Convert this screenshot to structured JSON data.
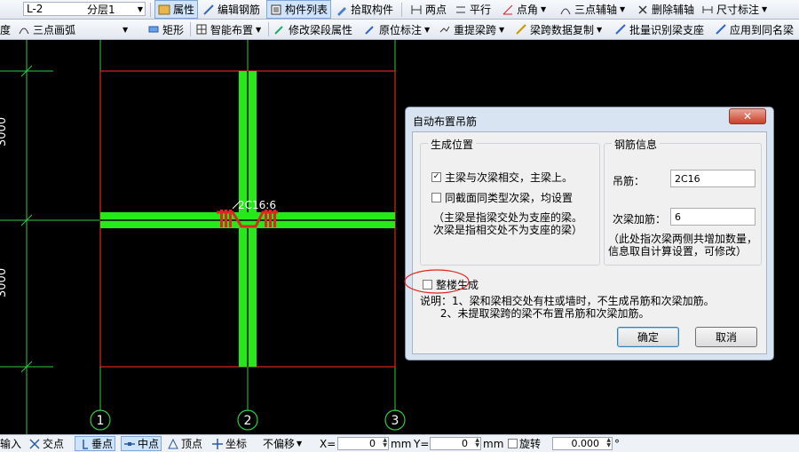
{
  "toolbar1": {
    "layer_combo": "L-2",
    "floor_combo": "分层1",
    "props": "属性",
    "edit_rebar": "编辑钢筋",
    "component_list": "构件列表",
    "pick_component": "拾取构件",
    "two_points": "两点",
    "parallel": "平行",
    "point_angle": "点角",
    "three_point_axis": "三点辅轴",
    "delete_axis": "删除辅轴",
    "dimension": "尺寸标注"
  },
  "toolbar2": {
    "degree": "度",
    "arc_combo": "三点画弧",
    "rect": "矩形",
    "smart_layout": "智能布置",
    "modify_beam_seg": "修改梁段属性",
    "origin_mark": "原位标注",
    "re_extract_span": "重提梁跨",
    "span_data_copy": "梁跨数据复制",
    "batch_identify": "批量识别梁支座",
    "apply_same_beam": "应用到同名梁"
  },
  "canvas": {
    "dim_top": "3000",
    "dim_bottom": "3000",
    "beam_label": "2C16:6",
    "axis_labels": [
      "1",
      "2",
      "3"
    ]
  },
  "dialog": {
    "title": "自动布置吊筋",
    "close": "✕",
    "gen_position_title": "生成位置",
    "opt_main_secondary": "主梁与次梁相交，主梁上。",
    "opt_main_secondary_checked": true,
    "opt_same_section": "同截面同类型次梁，均设置",
    "opt_same_section_checked": false,
    "position_note": "（主梁是指梁交处为支座的梁。\n次梁是指相交处不为支座的梁）",
    "rebar_info_title": "钢筋信息",
    "hanger_label": "吊筋：",
    "hanger_value": "2C16",
    "stirrup_add_label": "次梁加筋：",
    "stirrup_add_value": "6",
    "rebar_note": "（此处指次梁两侧共增加数量，\n信息取自计算设置，可修改）",
    "whole_building": "整楼生成",
    "whole_building_checked": false,
    "explanation": "说明：1、梁和梁相交处有柱或墙时，不生成吊筋和次梁加筋。\n      2、未提取梁跨的梁不布置吊筋和次梁加筋。",
    "ok": "确定",
    "cancel": "取消"
  },
  "statusbar": {
    "input": "输入",
    "intersection": "交点",
    "perpendicular": "垂点",
    "midpoint": "中点",
    "vertex": "顶点",
    "coordinate": "坐标",
    "offset_combo": "不偏移",
    "x_label": "X=",
    "x_value": "0",
    "mm1": "mm",
    "y_label": "Y=",
    "y_value": "0",
    "mm2": "mm",
    "rotate_label": "旋转",
    "rotate_value": "0.000",
    "degree_sign": "°"
  }
}
